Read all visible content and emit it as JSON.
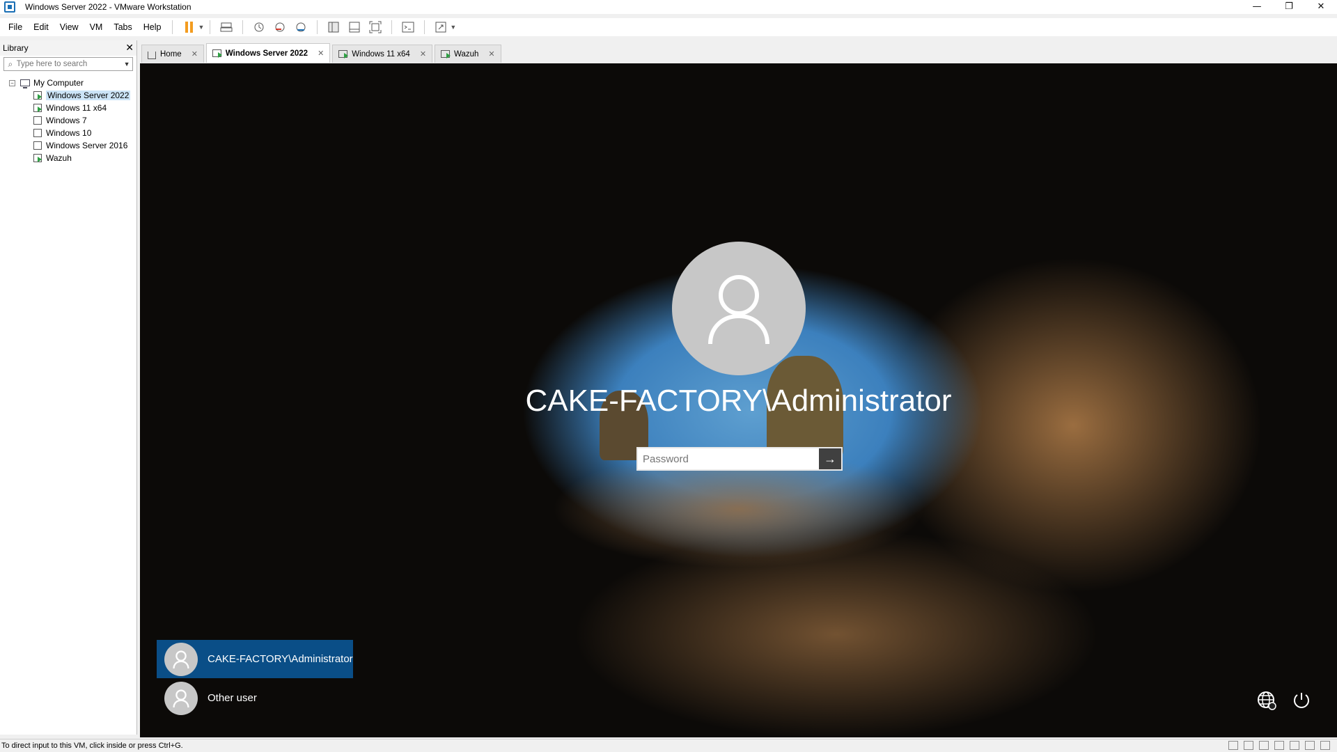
{
  "window": {
    "title": "Windows Server 2022 - VMware Workstation",
    "controls": {
      "minimize": "—",
      "restore": "❐",
      "close": "✕"
    }
  },
  "menu": {
    "items": [
      "File",
      "Edit",
      "View",
      "VM",
      "Tabs",
      "Help"
    ]
  },
  "library": {
    "title": "Library",
    "close": "✕",
    "search_placeholder": "Type here to search",
    "root": "My Computer",
    "items": [
      {
        "label": "Windows Server 2022",
        "running": true,
        "selected": true
      },
      {
        "label": "Windows 11 x64",
        "running": true,
        "selected": false
      },
      {
        "label": "Windows 7",
        "running": false,
        "selected": false
      },
      {
        "label": "Windows 10",
        "running": false,
        "selected": false
      },
      {
        "label": "Windows Server 2016",
        "running": false,
        "selected": false
      },
      {
        "label": "Wazuh",
        "running": true,
        "selected": false
      }
    ]
  },
  "tabs": [
    {
      "label": "Home",
      "active": false
    },
    {
      "label": "Windows Server 2022",
      "active": true
    },
    {
      "label": "Windows 11 x64",
      "active": false
    },
    {
      "label": "Wazuh",
      "active": false
    }
  ],
  "login": {
    "username": "CAKE-FACTORY\\Administrator",
    "password_placeholder": "Password",
    "submit_glyph": "→",
    "users": [
      {
        "label": "CAKE-FACTORY\\Administrator",
        "selected": true
      },
      {
        "label": "Other user",
        "selected": false
      }
    ],
    "icons": [
      "accessibility-globe-icon",
      "power-icon"
    ]
  },
  "status": {
    "message": "To direct input to this VM, click inside or press Ctrl+G."
  },
  "colors": {
    "selected_user_bg": "#0a4e87",
    "pause_accent": "#f39c1f",
    "running_accent": "#2ea043"
  }
}
